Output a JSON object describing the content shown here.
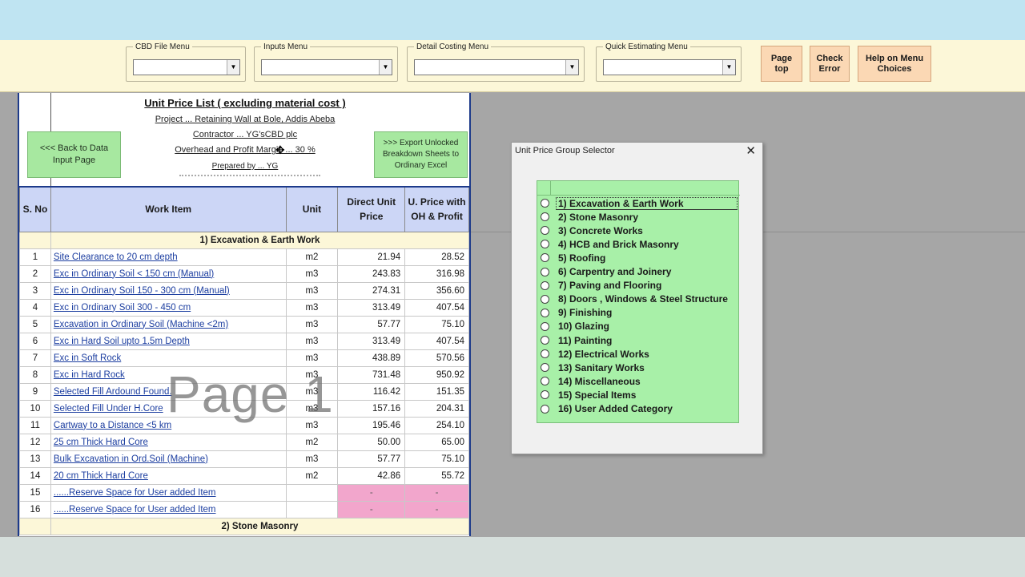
{
  "toolbar": {
    "menus": [
      {
        "label": "CBD File Menu",
        "value": ""
      },
      {
        "label": "Inputs Menu",
        "value": ""
      },
      {
        "label": "Detail Costing Menu",
        "value": ""
      },
      {
        "label": "Quick Estimating Menu",
        "value": ""
      }
    ],
    "buttons": [
      "Page\ntop",
      "Check\nError",
      "Help on Menu\nChoices"
    ]
  },
  "sheet": {
    "title": "Unit Price List ( excluding material cost )",
    "project": "Project ... Retaining Wall   at Bole, Addis Abeba",
    "contractor": "Contractor ... YG'sCBD plc",
    "overhead": "Overhead and Profit Margin ... 30 %",
    "prepared": "Prepared by ... YG",
    "back_button": "<<< Back to Data\nInput Page",
    "export_button": ">>> Export Unlocked\nBreakdown Sheets to\nOrdinary Excel",
    "headers": [
      "S. No",
      "Work Item",
      "Unit",
      "Direct Unit Price",
      "U. Price with OH & Profit"
    ],
    "category1": "1) Excavation & Earth Work",
    "rows": [
      {
        "no": "1",
        "item": "Site Clearance to 20 cm depth",
        "unit": "m2",
        "direct": "21.94",
        "oh": "28.52"
      },
      {
        "no": "2",
        "item": "Exc in Ordinary Soil < 150 cm (Manual)",
        "unit": "m3",
        "direct": "243.83",
        "oh": "316.98"
      },
      {
        "no": "3",
        "item": "Exc in Ordinary Soil 150 - 300 cm (Manual)",
        "unit": "m3",
        "direct": "274.31",
        "oh": "356.60"
      },
      {
        "no": "4",
        "item": "Exc in Ordinary Soil  300 - 450 cm",
        "unit": "m3",
        "direct": "313.49",
        "oh": "407.54"
      },
      {
        "no": "5",
        "item": "Excavation in Ordinary Soil (Machine <2m)",
        "unit": "m3",
        "direct": "57.77",
        "oh": "75.10"
      },
      {
        "no": "6",
        "item": "Exc in Hard Soil upto 1.5m Depth",
        "unit": "m3",
        "direct": "313.49",
        "oh": "407.54"
      },
      {
        "no": "7",
        "item": "Exc in Soft Rock",
        "unit": "m3",
        "direct": "438.89",
        "oh": "570.56"
      },
      {
        "no": "8",
        "item": "Exc in Hard Rock",
        "unit": "m3",
        "direct": "731.48",
        "oh": "950.92"
      },
      {
        "no": "9",
        "item": "Selected Fill Ardound Found.",
        "unit": "m3",
        "direct": "116.42",
        "oh": "151.35"
      },
      {
        "no": "10",
        "item": "Selected Fill Under H.Core",
        "unit": "m3",
        "direct": "157.16",
        "oh": "204.31"
      },
      {
        "no": "11",
        "item": "Cartway to a Distance <5 km",
        "unit": "m3",
        "direct": "195.46",
        "oh": "254.10"
      },
      {
        "no": "12",
        "item": "25 cm Thick Hard Core",
        "unit": "m2",
        "direct": "50.00",
        "oh": "65.00"
      },
      {
        "no": "13",
        "item": "Bulk Excavation in Ord.Soil (Machine)",
        "unit": "m3",
        "direct": "57.77",
        "oh": "75.10"
      },
      {
        "no": "14",
        "item": "20 cm Thick Hard Core",
        "unit": "m2",
        "direct": "42.86",
        "oh": "55.72"
      }
    ],
    "reserve_rows": [
      {
        "no": "15",
        "item": "......Reserve Space for User added Item",
        "direct": "-",
        "oh": "-"
      },
      {
        "no": "16",
        "item": "......Reserve Space for User added Item",
        "direct": "-",
        "oh": "-"
      }
    ],
    "category2": "2) Stone Masonry",
    "watermark": "Page 1"
  },
  "dialog": {
    "title": "Unit Price Group Selector",
    "close": "✕",
    "options": [
      "1) Excavation & Earth Work",
      "2) Stone Masonry",
      "3) Concrete Works",
      "4) HCB and Brick Masonry",
      "5)  Roofing",
      "6) Carpentry and Joinery",
      "7) Paving and Flooring",
      "8) Doors , Windows & Steel Structure",
      "9) Finishing",
      "10) Glazing",
      "11) Painting",
      "12) Electrical Works",
      "13) Sanitary Works",
      "14) Miscellaneous",
      "15) Special Items",
      "16) User Added Category"
    ],
    "selected_index": 0
  }
}
